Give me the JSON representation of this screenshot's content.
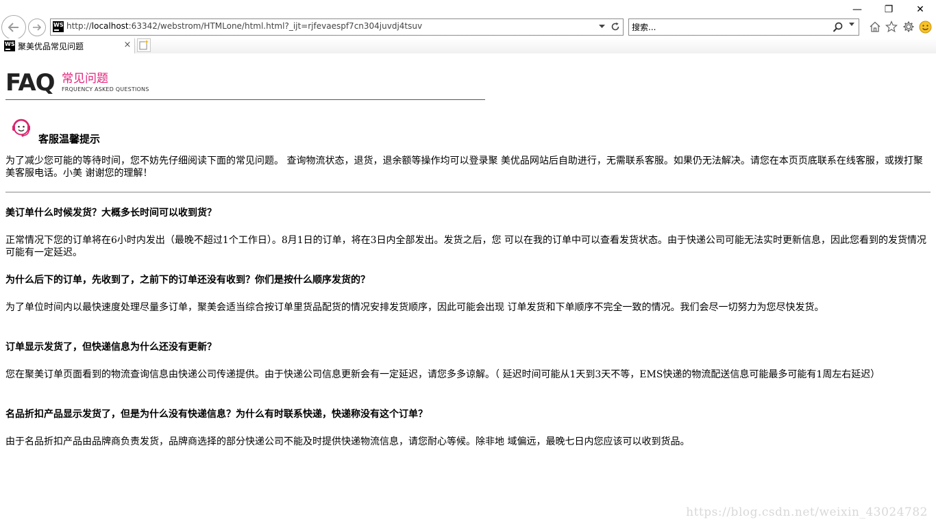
{
  "browser": {
    "window_controls": {
      "minimize": "—",
      "maximize": "❐",
      "close": "✕"
    },
    "url": {
      "prefix": "http://",
      "host": "localhost",
      "rest": ":63342/webstrom/HTMLone/html.html?_ijt=rjfevaespf7cn304juvdj4tsuv"
    },
    "search_placeholder": "搜索...",
    "tab": {
      "title": "聚美优品常见问题",
      "close": "×",
      "favicon": "WS"
    },
    "icons": {
      "home": "home-icon",
      "favorites": "star-icon",
      "tools": "gear-icon",
      "feedback": "smiley-icon"
    }
  },
  "page": {
    "logo": {
      "big": "FAQ",
      "cn": "常见问题",
      "en": "FRQUENCY ASKED QUESTIONS"
    },
    "tip": {
      "title": "客服温馨提示",
      "text": "为了减少您可能的等待时间，您不妨先仔细阅读下面的常见问题。 查询物流状态，退货，退余额等操作均可以登录聚 美优品网站后自助进行，无需联系客服。如果仍无法解决。请您在本页页底联系在线客服，或拨打聚美客服电话。小美 谢谢您的理解！"
    },
    "faqs": [
      {
        "question": "美订单什么时候发货？大概多长时间可以收到货？",
        "answer": "正常情况下您的订单将在6小时内发出（最晚不超过1个工作日）。8月1日的订单，将在3日内全部发出。发货之后，您 可以在我的订单中可以查看发货状态。由于快递公司可能无法实时更新信息，因此您看到的发货情况可能有一定延迟。"
      },
      {
        "question": "为什么后下的订单，先收到了，之前下的订单还没有收到？你们是按什么顺序发货的？",
        "answer": "为了单位时间内以最快速度处理尽量多订单，聚美会适当综合按订单里货品配货的情况安排发货顺序，因此可能会出现 订单发货和下单顺序不完全一致的情况。我们会尽一切努力为您尽快发货。"
      },
      {
        "question": "订单显示发货了，但快递信息为什么还没有更新？",
        "answer": "您在聚美订单页面看到的物流查询信息由快递公司传递提供。由于快递公司信息更新会有一定延迟，请您多多谅解。（ 延迟时间可能从1天到3天不等，EMS快递的物流配送信息可能最多可能有1周左右延迟）"
      },
      {
        "question": "名品折扣产品显示发货了，但是为什么没有快递信息？为什么有时联系快递，快递称没有这个订单？",
        "answer": "由于名品折扣产品由品牌商负责发货，品牌商选择的部分快递公司不能及时提供快递物流信息，请您耐心等候。除非地 域偏远，最晚七日内您应该可以收到货品。"
      }
    ],
    "watermark": "https://blog.csdn.net/weixin_43024782"
  }
}
